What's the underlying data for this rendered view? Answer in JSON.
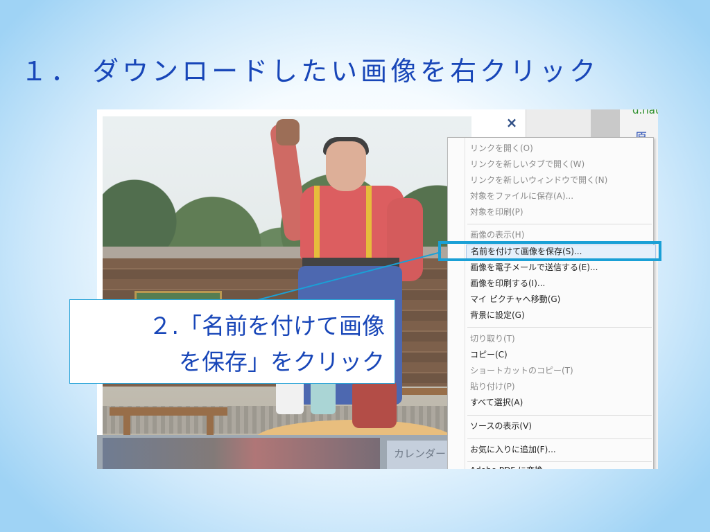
{
  "slide": {
    "title": "１． ダウンロードしたい画像を右クリック"
  },
  "viewer": {
    "close_glyph": "×"
  },
  "browser": {
    "url_fragment": "d.nau",
    "side_text": "原寸",
    "calendar_tab": "カレンダー"
  },
  "context_menu": {
    "items": [
      {
        "label": "リンクを開く(O)",
        "disabled": true
      },
      {
        "label": "リンクを新しいタブで開く(W)",
        "disabled": true
      },
      {
        "label": "リンクを新しいウィンドウで開く(N)",
        "disabled": true
      },
      {
        "label": "対象をファイルに保存(A)...",
        "disabled": true
      },
      {
        "label": "対象を印刷(P)",
        "disabled": true
      },
      {
        "label": "画像の表示(H)",
        "disabled": true
      },
      {
        "label": "名前を付けて画像を保存(S)...",
        "disabled": false,
        "selected": true
      },
      {
        "label": "画像を電子メールで送信する(E)...",
        "disabled": false
      },
      {
        "label": "画像を印刷する(I)...",
        "disabled": false
      },
      {
        "label": "マイ ピクチャへ移動(G)",
        "disabled": false
      },
      {
        "label": "背景に設定(G)",
        "disabled": false
      },
      {
        "label": "切り取り(T)",
        "disabled": true
      },
      {
        "label": "コピー(C)",
        "disabled": false
      },
      {
        "label": "ショートカットのコピー(T)",
        "disabled": true
      },
      {
        "label": "貼り付け(P)",
        "disabled": true
      },
      {
        "label": "すべて選択(A)",
        "disabled": false
      },
      {
        "label": "ソースの表示(V)",
        "disabled": false
      },
      {
        "label": "お気に入りに追加(F)...",
        "disabled": false
      },
      {
        "label": "Adobe PDF に変換",
        "disabled": false
      }
    ]
  },
  "callout": {
    "line1": "２.「名前を付けて画像",
    "line2": "を保存」をクリック"
  },
  "colors": {
    "title_blue": "#1846b8",
    "highlight_frame": "#1aa0d6",
    "menu_selected_bg": "#e5f0fb"
  }
}
